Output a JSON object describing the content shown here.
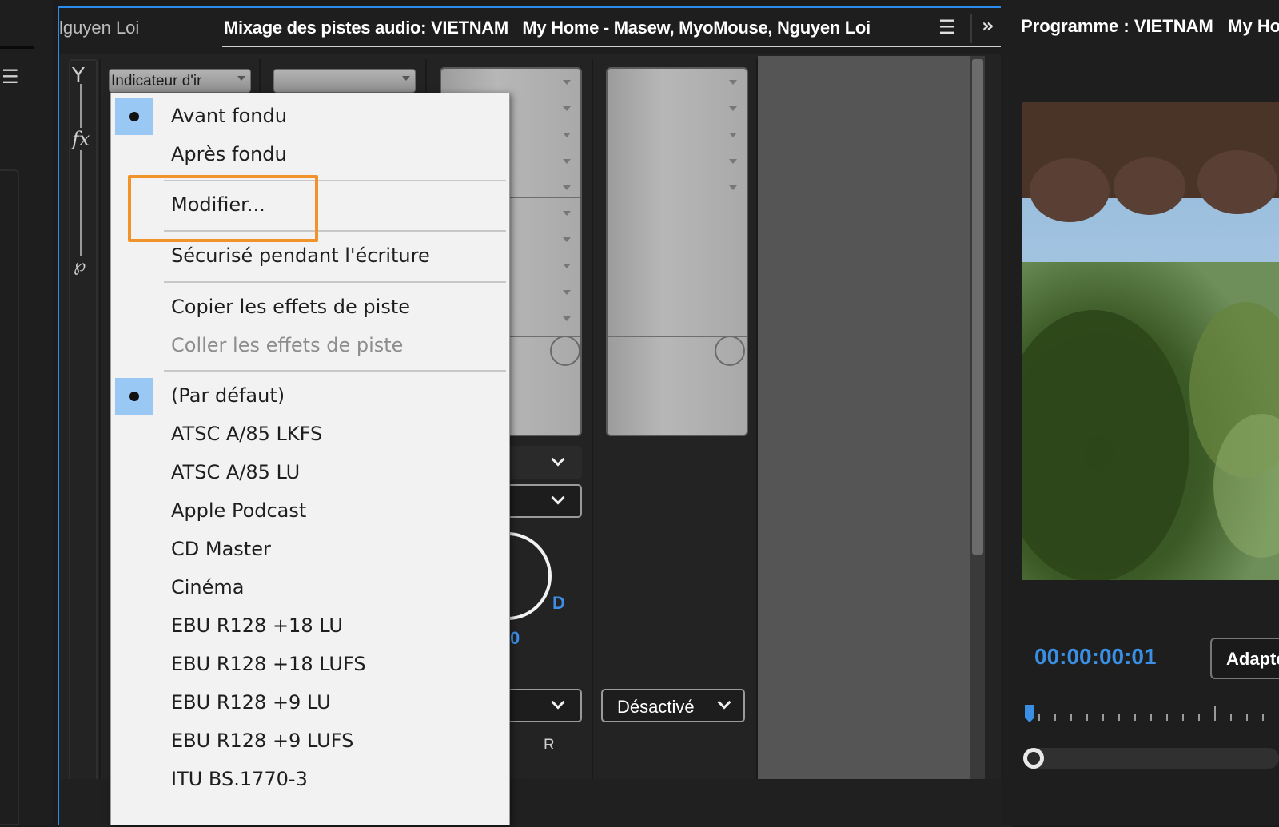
{
  "left_panel": {
    "menu_icon": "hamburger-icon"
  },
  "mixer": {
    "tab_prev": "lguyen Loi",
    "tab_active": "Mixage des pistes audio: VIETNAM   My Home - Masew, MyoMouse, Nguyen Loi",
    "menu_icon": "hamburger-icon",
    "more_icon": "double-chevron-right-icon",
    "fx_label": "fx",
    "track1_dropdown": "Indicateur d'ir",
    "track3_output": "Désactivé",
    "pan_label": "D",
    "pan_value": "0",
    "record_label": "R"
  },
  "context_menu": {
    "items": [
      {
        "label": "Avant fondu",
        "checked": true,
        "disabled": false
      },
      {
        "label": "Après fondu",
        "checked": false,
        "disabled": false
      },
      {
        "label": "Modifier...",
        "checked": false,
        "disabled": false,
        "highlighted": true
      },
      {
        "label": "Sécurisé pendant l'écriture",
        "checked": false,
        "disabled": false
      },
      {
        "label": "Copier les effets de piste",
        "checked": false,
        "disabled": false
      },
      {
        "label": "Coller les effets de piste",
        "checked": false,
        "disabled": true
      },
      {
        "label": "(Par défaut)",
        "checked": true,
        "disabled": false
      },
      {
        "label": "ATSC A/85 LKFS",
        "checked": false,
        "disabled": false
      },
      {
        "label": "ATSC A/85 LU",
        "checked": false,
        "disabled": false
      },
      {
        "label": "Apple Podcast",
        "checked": false,
        "disabled": false
      },
      {
        "label": "CD Master",
        "checked": false,
        "disabled": false
      },
      {
        "label": "Cinéma",
        "checked": false,
        "disabled": false
      },
      {
        "label": "EBU R128 +18 LU",
        "checked": false,
        "disabled": false
      },
      {
        "label": "EBU R128 +18 LUFS",
        "checked": false,
        "disabled": false
      },
      {
        "label": "EBU R128 +9 LU",
        "checked": false,
        "disabled": false
      },
      {
        "label": "EBU R128 +9 LUFS",
        "checked": false,
        "disabled": false
      },
      {
        "label": "ITU BS.1770-3",
        "checked": false,
        "disabled": false
      }
    ],
    "highlight_color": "#f0932b",
    "check_bg_color": "#9ac8f4"
  },
  "program": {
    "title": "Programme : VIETNAM   My Home",
    "timecode": "00:00:00:01",
    "fit_label": "Adapter",
    "timecode_color": "#3a8fe4"
  },
  "colors": {
    "accent": "#2d8ceb"
  }
}
